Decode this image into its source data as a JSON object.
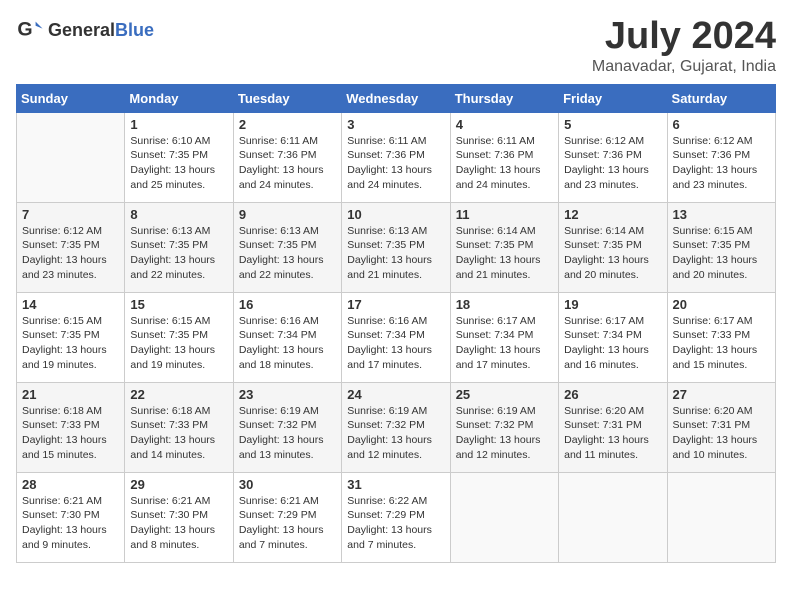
{
  "header": {
    "logo_general": "General",
    "logo_blue": "Blue",
    "month_title": "July 2024",
    "location": "Manavadar, Gujarat, India"
  },
  "days_of_week": [
    "Sunday",
    "Monday",
    "Tuesday",
    "Wednesday",
    "Thursday",
    "Friday",
    "Saturday"
  ],
  "weeks": [
    [
      {
        "day": "",
        "info": ""
      },
      {
        "day": "1",
        "info": "Sunrise: 6:10 AM\nSunset: 7:35 PM\nDaylight: 13 hours\nand 25 minutes."
      },
      {
        "day": "2",
        "info": "Sunrise: 6:11 AM\nSunset: 7:36 PM\nDaylight: 13 hours\nand 24 minutes."
      },
      {
        "day": "3",
        "info": "Sunrise: 6:11 AM\nSunset: 7:36 PM\nDaylight: 13 hours\nand 24 minutes."
      },
      {
        "day": "4",
        "info": "Sunrise: 6:11 AM\nSunset: 7:36 PM\nDaylight: 13 hours\nand 24 minutes."
      },
      {
        "day": "5",
        "info": "Sunrise: 6:12 AM\nSunset: 7:36 PM\nDaylight: 13 hours\nand 23 minutes."
      },
      {
        "day": "6",
        "info": "Sunrise: 6:12 AM\nSunset: 7:36 PM\nDaylight: 13 hours\nand 23 minutes."
      }
    ],
    [
      {
        "day": "7",
        "info": "Sunrise: 6:12 AM\nSunset: 7:35 PM\nDaylight: 13 hours\nand 23 minutes."
      },
      {
        "day": "8",
        "info": "Sunrise: 6:13 AM\nSunset: 7:35 PM\nDaylight: 13 hours\nand 22 minutes."
      },
      {
        "day": "9",
        "info": "Sunrise: 6:13 AM\nSunset: 7:35 PM\nDaylight: 13 hours\nand 22 minutes."
      },
      {
        "day": "10",
        "info": "Sunrise: 6:13 AM\nSunset: 7:35 PM\nDaylight: 13 hours\nand 21 minutes."
      },
      {
        "day": "11",
        "info": "Sunrise: 6:14 AM\nSunset: 7:35 PM\nDaylight: 13 hours\nand 21 minutes."
      },
      {
        "day": "12",
        "info": "Sunrise: 6:14 AM\nSunset: 7:35 PM\nDaylight: 13 hours\nand 20 minutes."
      },
      {
        "day": "13",
        "info": "Sunrise: 6:15 AM\nSunset: 7:35 PM\nDaylight: 13 hours\nand 20 minutes."
      }
    ],
    [
      {
        "day": "14",
        "info": "Sunrise: 6:15 AM\nSunset: 7:35 PM\nDaylight: 13 hours\nand 19 minutes."
      },
      {
        "day": "15",
        "info": "Sunrise: 6:15 AM\nSunset: 7:35 PM\nDaylight: 13 hours\nand 19 minutes."
      },
      {
        "day": "16",
        "info": "Sunrise: 6:16 AM\nSunset: 7:34 PM\nDaylight: 13 hours\nand 18 minutes."
      },
      {
        "day": "17",
        "info": "Sunrise: 6:16 AM\nSunset: 7:34 PM\nDaylight: 13 hours\nand 17 minutes."
      },
      {
        "day": "18",
        "info": "Sunrise: 6:17 AM\nSunset: 7:34 PM\nDaylight: 13 hours\nand 17 minutes."
      },
      {
        "day": "19",
        "info": "Sunrise: 6:17 AM\nSunset: 7:34 PM\nDaylight: 13 hours\nand 16 minutes."
      },
      {
        "day": "20",
        "info": "Sunrise: 6:17 AM\nSunset: 7:33 PM\nDaylight: 13 hours\nand 15 minutes."
      }
    ],
    [
      {
        "day": "21",
        "info": "Sunrise: 6:18 AM\nSunset: 7:33 PM\nDaylight: 13 hours\nand 15 minutes."
      },
      {
        "day": "22",
        "info": "Sunrise: 6:18 AM\nSunset: 7:33 PM\nDaylight: 13 hours\nand 14 minutes."
      },
      {
        "day": "23",
        "info": "Sunrise: 6:19 AM\nSunset: 7:32 PM\nDaylight: 13 hours\nand 13 minutes."
      },
      {
        "day": "24",
        "info": "Sunrise: 6:19 AM\nSunset: 7:32 PM\nDaylight: 13 hours\nand 12 minutes."
      },
      {
        "day": "25",
        "info": "Sunrise: 6:19 AM\nSunset: 7:32 PM\nDaylight: 13 hours\nand 12 minutes."
      },
      {
        "day": "26",
        "info": "Sunrise: 6:20 AM\nSunset: 7:31 PM\nDaylight: 13 hours\nand 11 minutes."
      },
      {
        "day": "27",
        "info": "Sunrise: 6:20 AM\nSunset: 7:31 PM\nDaylight: 13 hours\nand 10 minutes."
      }
    ],
    [
      {
        "day": "28",
        "info": "Sunrise: 6:21 AM\nSunset: 7:30 PM\nDaylight: 13 hours\nand 9 minutes."
      },
      {
        "day": "29",
        "info": "Sunrise: 6:21 AM\nSunset: 7:30 PM\nDaylight: 13 hours\nand 8 minutes."
      },
      {
        "day": "30",
        "info": "Sunrise: 6:21 AM\nSunset: 7:29 PM\nDaylight: 13 hours\nand 7 minutes."
      },
      {
        "day": "31",
        "info": "Sunrise: 6:22 AM\nSunset: 7:29 PM\nDaylight: 13 hours\nand 7 minutes."
      },
      {
        "day": "",
        "info": ""
      },
      {
        "day": "",
        "info": ""
      },
      {
        "day": "",
        "info": ""
      }
    ]
  ]
}
